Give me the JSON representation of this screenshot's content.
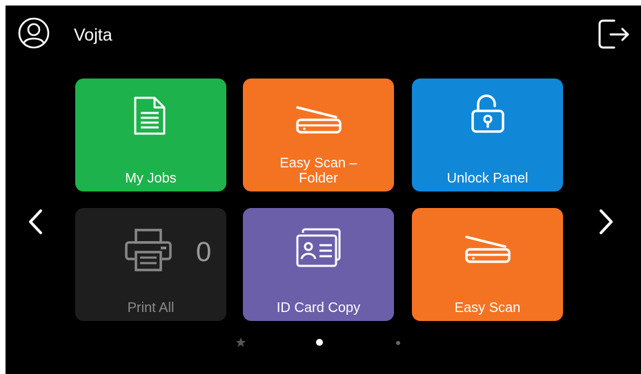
{
  "header": {
    "user_name": "Vojta",
    "user_icon": "user-circle-icon",
    "logout_icon": "logout-icon"
  },
  "tiles": [
    {
      "label": "My Jobs",
      "icon": "document-icon",
      "color": "#1db24b"
    },
    {
      "label": "Easy Scan –\nFolder",
      "icon": "scanner-icon",
      "color": "#f47322"
    },
    {
      "label": "Unlock Panel",
      "icon": "unlock-icon",
      "color": "#1187d8"
    },
    {
      "label": "Print All",
      "icon": "printer-icon",
      "color": "#1e1e1e",
      "count": "0"
    },
    {
      "label": "ID Card Copy",
      "icon": "id-card-icon",
      "color": "#6a5fa8"
    },
    {
      "label": "Easy Scan",
      "icon": "scanner-icon",
      "color": "#f47322"
    }
  ],
  "navigation": {
    "prev_icon": "chevron-left-icon",
    "next_icon": "chevron-right-icon"
  },
  "pagination": {
    "pages": [
      "favorites",
      "page-1",
      "page-2"
    ],
    "active_index": 1
  }
}
